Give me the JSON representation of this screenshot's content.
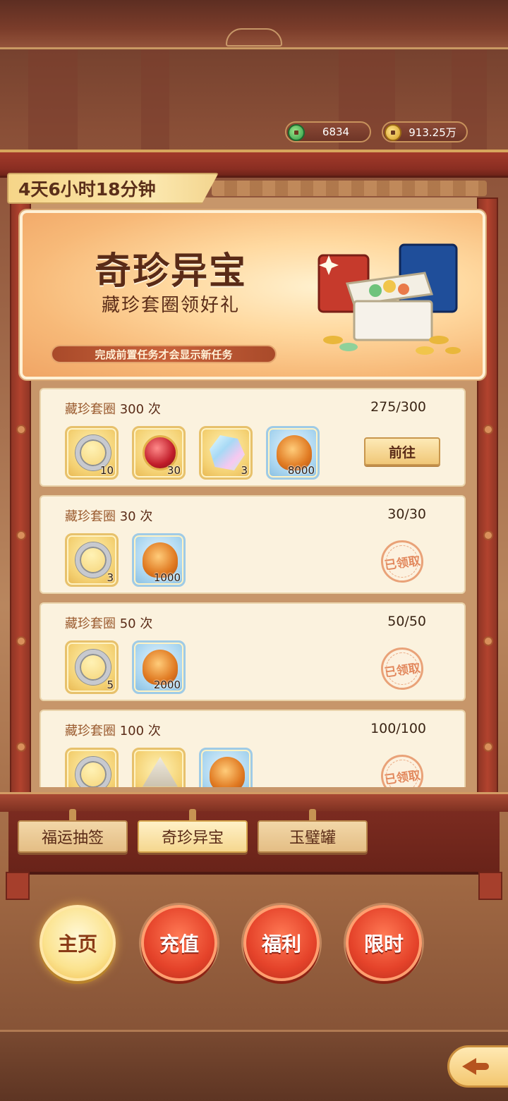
{
  "currencies": {
    "jade": {
      "value": "6834",
      "icon": "jade-coin-icon"
    },
    "coin": {
      "value": "913.25万",
      "icon": "gold-coin-icon"
    }
  },
  "timer": "4天6小时18分钟",
  "hero": {
    "title": "奇珍异宝",
    "subtitle": "藏珍套圈领好礼",
    "note": "完成前置任务才会显示新任务"
  },
  "tasks": [
    {
      "label": "藏珍套圈",
      "count": "300 次",
      "progress": "275/300",
      "rewards": [
        {
          "icon": "ring-icon",
          "qty": "10"
        },
        {
          "icon": "pendant-icon",
          "qty": "30"
        },
        {
          "icon": "gem-icon",
          "qty": "3"
        },
        {
          "icon": "shell-icon",
          "qty": "8000"
        }
      ],
      "action": "前往",
      "state": "go"
    },
    {
      "label": "藏珍套圈",
      "count": "30 次",
      "progress": "30/30",
      "rewards": [
        {
          "icon": "ring-icon",
          "qty": "3"
        },
        {
          "icon": "shell-icon",
          "qty": "1000"
        }
      ],
      "action": "已领取",
      "state": "claimed"
    },
    {
      "label": "藏珍套圈",
      "count": "50 次",
      "progress": "50/50",
      "rewards": [
        {
          "icon": "ring-icon",
          "qty": "5"
        },
        {
          "icon": "shell-icon",
          "qty": "2000"
        }
      ],
      "action": "已领取",
      "state": "claimed"
    },
    {
      "label": "藏珍套圈",
      "count": "100 次",
      "progress": "100/100",
      "rewards": [
        {
          "icon": "ring-icon",
          "qty": ""
        },
        {
          "icon": "tent-icon",
          "qty": ""
        },
        {
          "icon": "shell-icon",
          "qty": ""
        }
      ],
      "action": "已领取",
      "state": "claimed"
    }
  ],
  "tabs": [
    "福运抽签",
    "奇珍异宝",
    "玉璧罐"
  ],
  "active_tab": "奇珍异宝",
  "nav": [
    "主页",
    "充值",
    "福利",
    "限时"
  ],
  "active_nav": "主页",
  "colors": {
    "frame_red": "#a23a2a",
    "gold": "#f4d173",
    "claimed_stamp": "#e07d50"
  }
}
